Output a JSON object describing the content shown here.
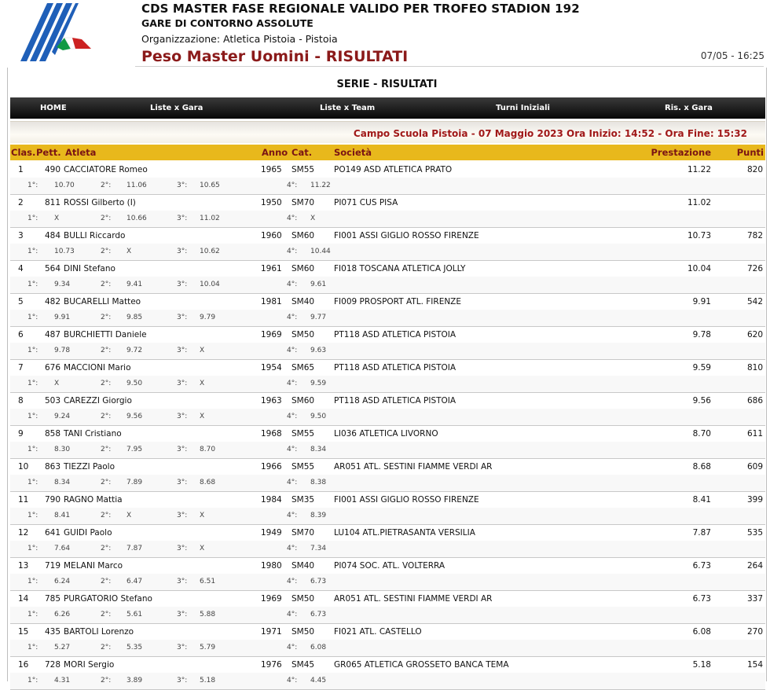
{
  "header": {
    "title": "CDS MASTER FASE REGIONALE VALIDO PER TROFEO STADION 192",
    "subtitle": "GARE DI CONTORNO ASSOLUTE",
    "organization": "Organizzazione: Atletica Pistoia - Pistoia",
    "event": "Peso Master Uomini - RISULTATI",
    "timestamp": "07/05 - 16:25",
    "colors": {
      "event": "#8b1a1a",
      "logo_blue": "#1f5fb8",
      "flag_green": "#119944",
      "flag_red": "#cc2222"
    }
  },
  "serie_title": "SERIE - RISULTATI",
  "nav": [
    "HOME",
    "Liste x Gara",
    "Liste x Team",
    "Turni Iniziali",
    "Ris. x Gara"
  ],
  "info": "Campo Scuola Pistoia - 07 Maggio 2023 Ora Inizio: 14:52 - Ora Fine: 15:32",
  "columns": [
    "Clas.",
    "Pett.",
    "Atleta",
    "Anno",
    "Cat.",
    "Società",
    "Prestazione",
    "Punti"
  ],
  "attempt_labels": [
    "1°:",
    "2°:",
    "3°:",
    "4°:"
  ],
  "results": [
    {
      "clas": "1",
      "pett": "490",
      "atleta": "CACCIATORE Romeo",
      "anno": "1965",
      "cat": "SM55",
      "societa": "PO149 ASD ATLETICA PRATO",
      "prest": "11.22",
      "punti": "820",
      "att": [
        "10.70",
        "11.06",
        "10.65",
        "11.22"
      ]
    },
    {
      "clas": "2",
      "pett": "811",
      "atleta": "ROSSI Gilberto (I)",
      "anno": "1950",
      "cat": "SM70",
      "societa": "PI071 CUS PISA",
      "prest": "11.02",
      "punti": "",
      "att": [
        "X",
        "10.66",
        "11.02",
        "X"
      ]
    },
    {
      "clas": "3",
      "pett": "484",
      "atleta": "BULLI Riccardo",
      "anno": "1960",
      "cat": "SM60",
      "societa": "FI001 ASSI GIGLIO ROSSO FIRENZE",
      "prest": "10.73",
      "punti": "782",
      "att": [
        "10.73",
        "X",
        "10.62",
        "10.44"
      ]
    },
    {
      "clas": "4",
      "pett": "564",
      "atleta": "DINI Stefano",
      "anno": "1961",
      "cat": "SM60",
      "societa": "FI018 TOSCANA ATLETICA JOLLY",
      "prest": "10.04",
      "punti": "726",
      "att": [
        "9.34",
        "9.41",
        "10.04",
        "9.61"
      ]
    },
    {
      "clas": "5",
      "pett": "482",
      "atleta": "BUCARELLI Matteo",
      "anno": "1981",
      "cat": "SM40",
      "societa": "FI009 PROSPORT ATL. FIRENZE",
      "prest": "9.91",
      "punti": "542",
      "att": [
        "9.91",
        "9.85",
        "9.79",
        "9.77"
      ]
    },
    {
      "clas": "6",
      "pett": "487",
      "atleta": "BURCHIETTI Daniele",
      "anno": "1969",
      "cat": "SM50",
      "societa": "PT118 ASD ATLETICA PISTOIA",
      "prest": "9.78",
      "punti": "620",
      "att": [
        "9.78",
        "9.72",
        "X",
        "9.63"
      ]
    },
    {
      "clas": "7",
      "pett": "676",
      "atleta": "MACCIONI Mario",
      "anno": "1954",
      "cat": "SM65",
      "societa": "PT118 ASD ATLETICA PISTOIA",
      "prest": "9.59",
      "punti": "810",
      "att": [
        "X",
        "9.50",
        "X",
        "9.59"
      ]
    },
    {
      "clas": "8",
      "pett": "503",
      "atleta": "CAREZZI Giorgio",
      "anno": "1963",
      "cat": "SM60",
      "societa": "PT118 ASD ATLETICA PISTOIA",
      "prest": "9.56",
      "punti": "686",
      "att": [
        "9.24",
        "9.56",
        "X",
        "9.50"
      ]
    },
    {
      "clas": "9",
      "pett": "858",
      "atleta": "TANI Cristiano",
      "anno": "1968",
      "cat": "SM55",
      "societa": "LI036 ATLETICA LIVORNO",
      "prest": "8.70",
      "punti": "611",
      "att": [
        "8.30",
        "7.95",
        "8.70",
        "8.34"
      ]
    },
    {
      "clas": "10",
      "pett": "863",
      "atleta": "TIEZZI Paolo",
      "anno": "1966",
      "cat": "SM55",
      "societa": "AR051 ATL. SESTINI FIAMME VERDI AR",
      "prest": "8.68",
      "punti": "609",
      "att": [
        "8.34",
        "7.89",
        "8.68",
        "8.38"
      ]
    },
    {
      "clas": "11",
      "pett": "790",
      "atleta": "RAGNO Mattia",
      "anno": "1984",
      "cat": "SM35",
      "societa": "FI001 ASSI GIGLIO ROSSO FIRENZE",
      "prest": "8.41",
      "punti": "399",
      "att": [
        "8.41",
        "X",
        "X",
        "8.39"
      ]
    },
    {
      "clas": "12",
      "pett": "641",
      "atleta": "GUIDI Paolo",
      "anno": "1949",
      "cat": "SM70",
      "societa": "LU104 ATL.PIETRASANTA VERSILIA",
      "prest": "7.87",
      "punti": "535",
      "att": [
        "7.64",
        "7.87",
        "X",
        "7.34"
      ]
    },
    {
      "clas": "13",
      "pett": "719",
      "atleta": "MELANI Marco",
      "anno": "1980",
      "cat": "SM40",
      "societa": "PI074 SOC. ATL. VOLTERRA",
      "prest": "6.73",
      "punti": "264",
      "att": [
        "6.24",
        "6.47",
        "6.51",
        "6.73"
      ]
    },
    {
      "clas": "14",
      "pett": "785",
      "atleta": "PURGATORIO Stefano",
      "anno": "1969",
      "cat": "SM50",
      "societa": "AR051 ATL. SESTINI FIAMME VERDI AR",
      "prest": "6.73",
      "punti": "337",
      "att": [
        "6.26",
        "5.61",
        "5.88",
        "6.73"
      ]
    },
    {
      "clas": "15",
      "pett": "435",
      "atleta": "BARTOLI Lorenzo",
      "anno": "1971",
      "cat": "SM50",
      "societa": "FI021 ATL. CASTELLO",
      "prest": "6.08",
      "punti": "270",
      "att": [
        "5.27",
        "5.35",
        "5.79",
        "6.08"
      ]
    },
    {
      "clas": "16",
      "pett": "728",
      "atleta": "MORI Sergio",
      "anno": "1976",
      "cat": "SM45",
      "societa": "GR065 ATLETICA GROSSETO BANCA TEMA",
      "prest": "5.18",
      "punti": "154",
      "att": [
        "4.31",
        "3.89",
        "5.18",
        "4.45"
      ]
    }
  ]
}
